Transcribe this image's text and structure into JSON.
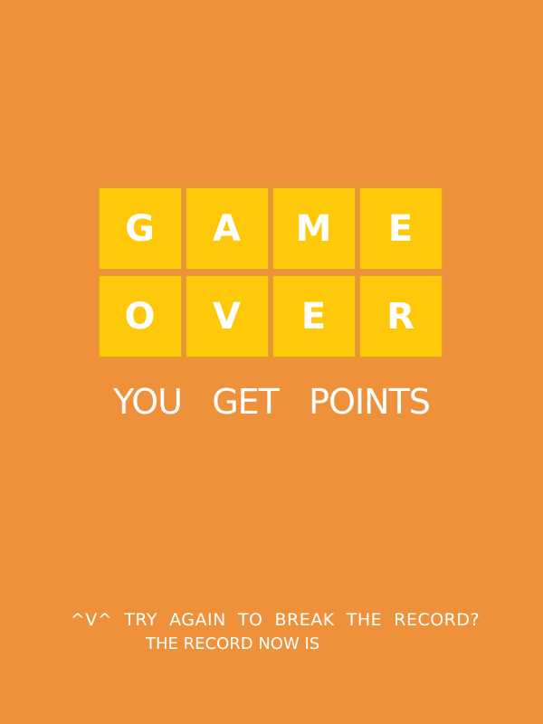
{
  "game_over": {
    "row1": [
      "G",
      "A",
      "M",
      "E"
    ],
    "row2": [
      "O",
      "V",
      "E",
      "R"
    ]
  },
  "points_line": "YOU   GET   POINTS",
  "try_again_text": "^V^  TRY  AGAIN  TO  BREAK  THE  RECORD?",
  "record_text": "THE RECORD NOW IS",
  "colors": {
    "background": "#ef913a",
    "tile": "#fec80b",
    "text": "#ffffff"
  }
}
